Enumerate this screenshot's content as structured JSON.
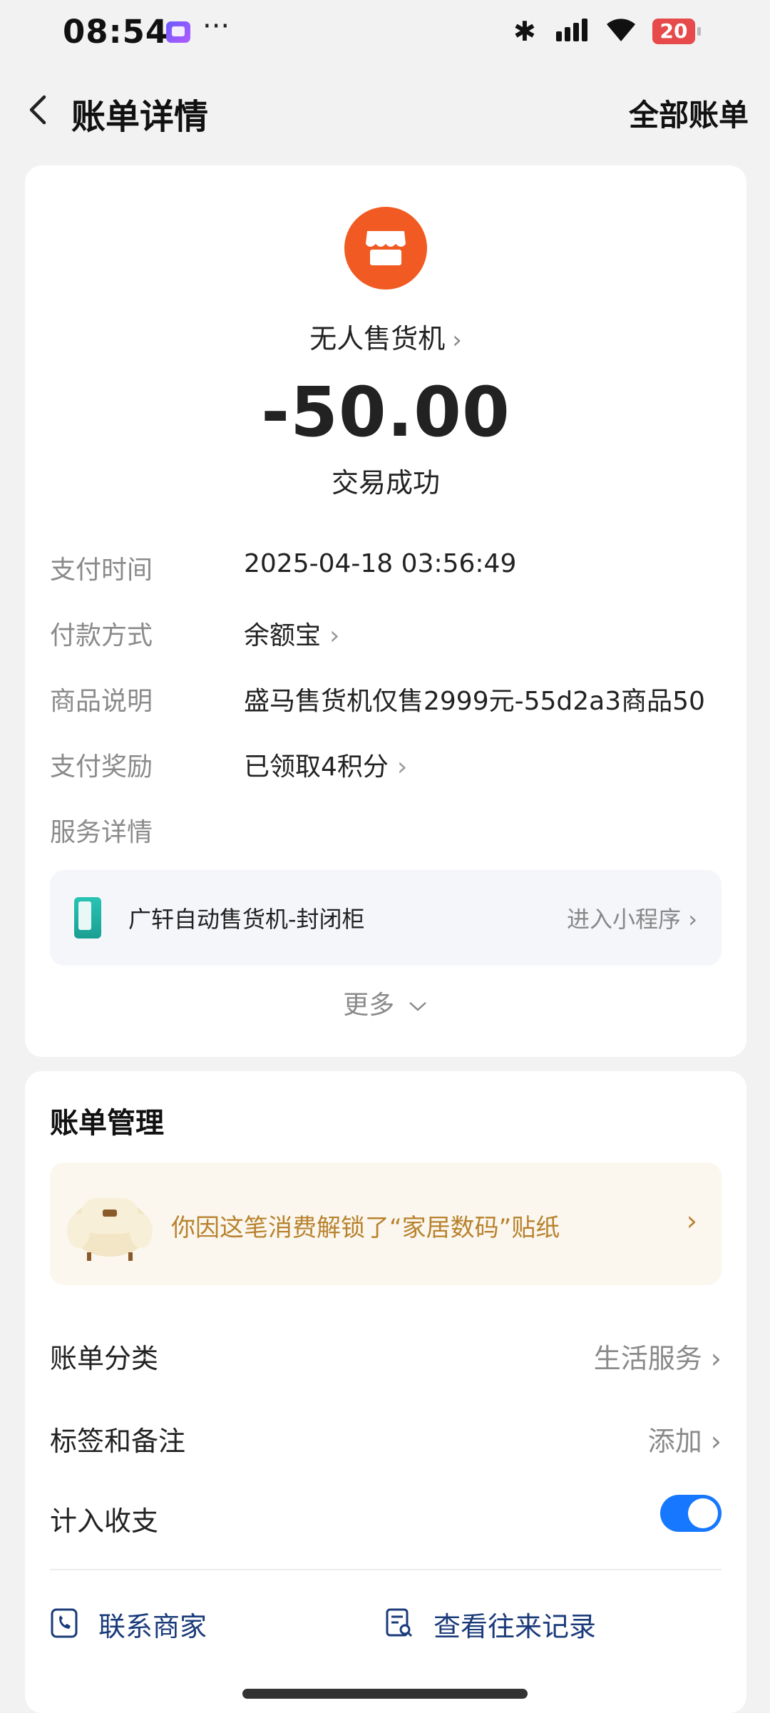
{
  "status_bar": {
    "time": "08:54",
    "extra": "···",
    "battery": "20"
  },
  "header": {
    "title": "账单详情",
    "all_bills": "全部账单"
  },
  "summary": {
    "merchant": "无人售货机",
    "amount": "-50.00",
    "status": "交易成功"
  },
  "details": [
    {
      "label": "支付时间",
      "value": "2025-04-18 03:56:49",
      "chevron": false
    },
    {
      "label": "付款方式",
      "value": "余额宝",
      "chevron": true
    },
    {
      "label": "商品说明",
      "value": "盛马售货机仅售2999元-55d2a3商品50",
      "chevron": false
    },
    {
      "label": "支付奖励",
      "value": "已领取4积分",
      "chevron": true
    },
    {
      "label": "服务详情",
      "value": "",
      "chevron": false
    }
  ],
  "service": {
    "name": "广轩自动售货机-封闭柜",
    "link": "进入小程序"
  },
  "more": "更多",
  "management": {
    "title": "账单管理",
    "sticker": "你因这笔消费解锁了“家居数码”贴纸",
    "category": {
      "label": "账单分类",
      "value": "生活服务"
    },
    "tags": {
      "label": "标签和备注",
      "value": "添加"
    },
    "include": {
      "label": "计入收支",
      "enabled": true
    },
    "contact": "联系商家",
    "history": "查看往来记录"
  },
  "colors": {
    "accent": "#1677ff",
    "merchant": "#f15a22",
    "sticker_text": "#b8822d"
  }
}
